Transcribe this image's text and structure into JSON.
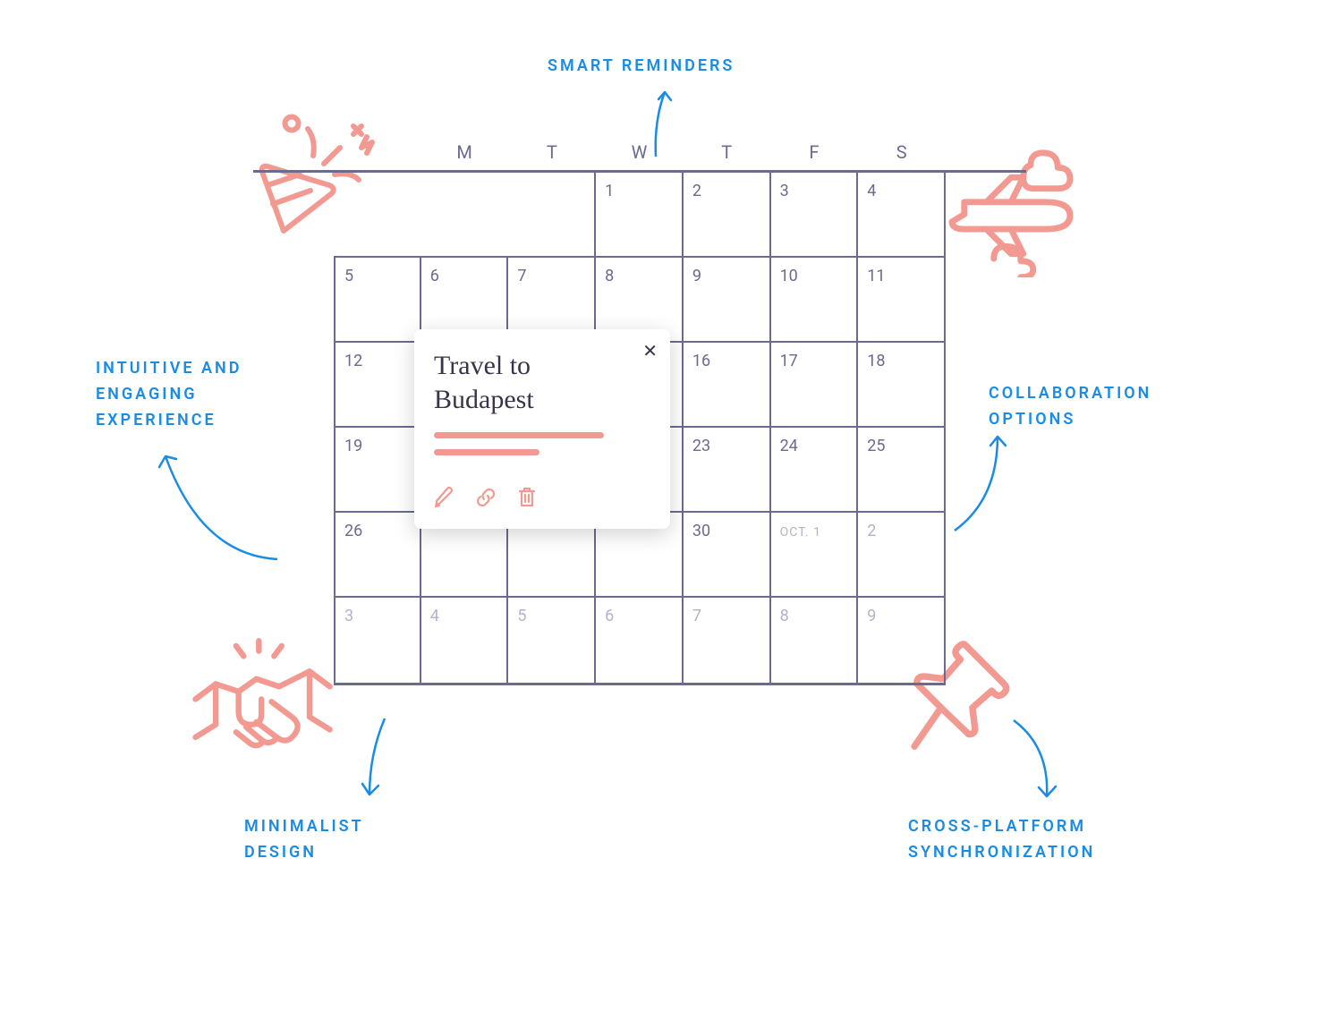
{
  "labels": {
    "smart": "SMART REMINDERS",
    "intuitive_l1": "INTUITIVE AND",
    "intuitive_l2": "ENGAGING",
    "intuitive_l3": "EXPERIENCE",
    "collab_l1": "COLLABORATION",
    "collab_l2": "OPTIONS",
    "minimal_l1": "MINIMALIST",
    "minimal_l2": "DESIGN",
    "cross_l1": "CROSS-PLATFORM",
    "cross_l2": "SYNCHRONIZATION"
  },
  "popup": {
    "title": "Travel to Budapest",
    "close": "✕"
  },
  "calendar": {
    "day_headers": [
      "",
      "",
      "M",
      "T",
      "W",
      "T",
      "F",
      "S"
    ],
    "weeks": [
      [
        "",
        "",
        "",
        "1",
        "2",
        "3",
        "4"
      ],
      [
        "5",
        "6",
        "7",
        "8",
        "9",
        "10",
        "11"
      ],
      [
        "12",
        "",
        "",
        "",
        "16",
        "17",
        "18"
      ],
      [
        "19",
        "",
        "",
        "",
        "23",
        "24",
        "25"
      ],
      [
        "26",
        "",
        "",
        "",
        "30",
        "OCT. 1",
        "2"
      ],
      [
        "3",
        "4",
        "5",
        "6",
        "7",
        "8",
        "9"
      ]
    ]
  },
  "icons": {
    "confetti": "confetti-icon",
    "plane": "plane-icon",
    "handshake": "handshake-icon",
    "pin": "pushpin-icon",
    "edit": "pencil-icon",
    "link": "link-icon",
    "trash": "trash-icon",
    "close": "close-icon"
  }
}
